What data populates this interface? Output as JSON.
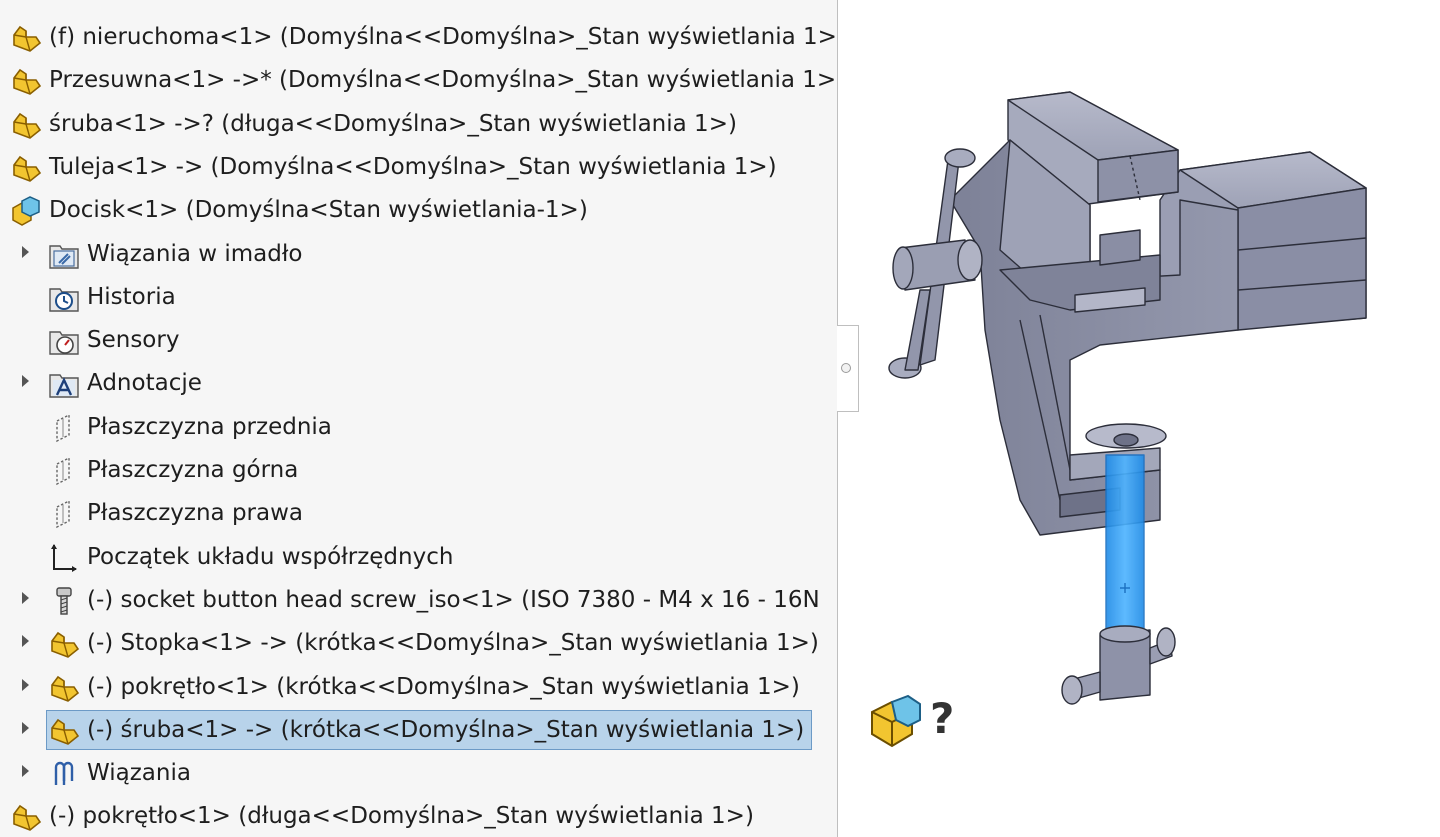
{
  "tree": {
    "items": [
      {
        "label": "(f) nieruchoma<1> (Domyślna<<Domyślna>_Stan wyświetlania 1>",
        "icon": "part-icon",
        "indent": 0,
        "arrow": false
      },
      {
        "label": "Przesuwna<1> ->* (Domyślna<<Domyślna>_Stan wyświetlania 1>",
        "icon": "part-icon",
        "indent": 0,
        "arrow": false
      },
      {
        "label": "śruba<1> ->? (długa<<Domyślna>_Stan wyświetlania 1>)",
        "icon": "part-icon",
        "indent": 0,
        "arrow": false
      },
      {
        "label": "Tuleja<1> -> (Domyślna<<Domyślna>_Stan wyświetlania 1>)",
        "icon": "part-icon",
        "indent": 0,
        "arrow": false
      },
      {
        "label": "Docisk<1> (Domyślna<Stan wyświetlania-1>)",
        "icon": "assembly-icon",
        "indent": 0,
        "arrow": false
      },
      {
        "label": "Wiązania w imadło",
        "icon": "mates-folder-icon",
        "indent": 1,
        "arrow": true
      },
      {
        "label": "Historia",
        "icon": "history-icon",
        "indent": 1,
        "arrow": false
      },
      {
        "label": "Sensory",
        "icon": "sensors-icon",
        "indent": 1,
        "arrow": false
      },
      {
        "label": "Adnotacje",
        "icon": "annotations-icon",
        "indent": 1,
        "arrow": true
      },
      {
        "label": "Płaszczyzna przednia",
        "icon": "plane-icon",
        "indent": 1,
        "arrow": false
      },
      {
        "label": "Płaszczyzna górna",
        "icon": "plane-icon",
        "indent": 1,
        "arrow": false
      },
      {
        "label": "Płaszczyzna prawa",
        "icon": "plane-icon",
        "indent": 1,
        "arrow": false
      },
      {
        "label": "Początek układu współrzędnych",
        "icon": "origin-icon",
        "indent": 1,
        "arrow": false
      },
      {
        "label": "(-) socket button head screw_iso<1> (ISO 7380 - M4 x 16 - 16N",
        "icon": "screw-icon",
        "indent": 1,
        "arrow": true
      },
      {
        "label": "(-) Stopka<1> -> (krótka<<Domyślna>_Stan wyświetlania 1>)",
        "icon": "part-icon",
        "indent": 1,
        "arrow": true
      },
      {
        "label": "(-) pokrętło<1> (krótka<<Domyślna>_Stan wyświetlania 1>)",
        "icon": "part-icon",
        "indent": 1,
        "arrow": true
      },
      {
        "label": "(-) śruba<1> -> (krótka<<Domyślna>_Stan wyświetlania 1>)",
        "icon": "part-icon",
        "indent": 1,
        "arrow": true,
        "selected": true
      },
      {
        "label": "Wiązania",
        "icon": "mates-icon",
        "indent": 1,
        "arrow": true
      },
      {
        "label": "(-) pokrętło<1> (długa<<Domyślna>_Stan wyświetlania 1>)",
        "icon": "part-icon",
        "indent": 0,
        "arrow": false
      }
    ]
  },
  "badge": {
    "icon": "assembly-question-icon",
    "symbol": "?"
  },
  "colors": {
    "part": "#f2c530",
    "part_dark": "#b8860b",
    "highlight": "#2c9cf0",
    "selection_bg": "#b8d3ea",
    "model_gray": "#8a8fa6"
  }
}
